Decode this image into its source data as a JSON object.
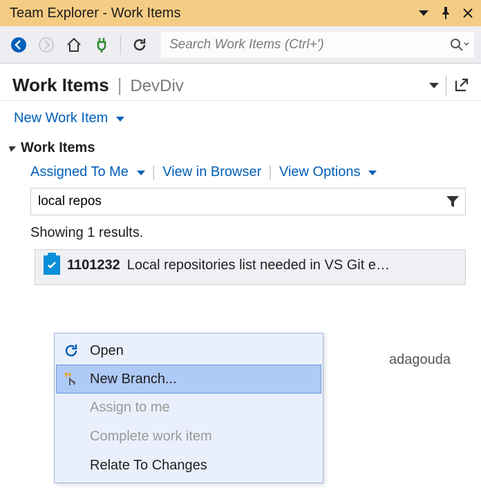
{
  "window": {
    "title": "Team Explorer - Work Items"
  },
  "toolbar": {
    "search_placeholder": "Search Work Items (Ctrl+')"
  },
  "header": {
    "title": "Work Items",
    "project": "DevDiv"
  },
  "new_item": {
    "label": "New Work Item"
  },
  "section": {
    "title": "Work Items",
    "filters": {
      "assigned": "Assigned To Me",
      "browser": "View in Browser",
      "options": "View Options"
    },
    "filter_value": "local repos",
    "results_text": "Showing 1 results."
  },
  "work_item": {
    "id": "1101232",
    "title": "Local repositories list needed in VS Git e…",
    "assignee_peek": "adagouda"
  },
  "context_menu": {
    "open": "Open",
    "new_branch": "New Branch...",
    "assign": "Assign to me",
    "complete": "Complete work item",
    "relate": "Relate To Changes"
  }
}
